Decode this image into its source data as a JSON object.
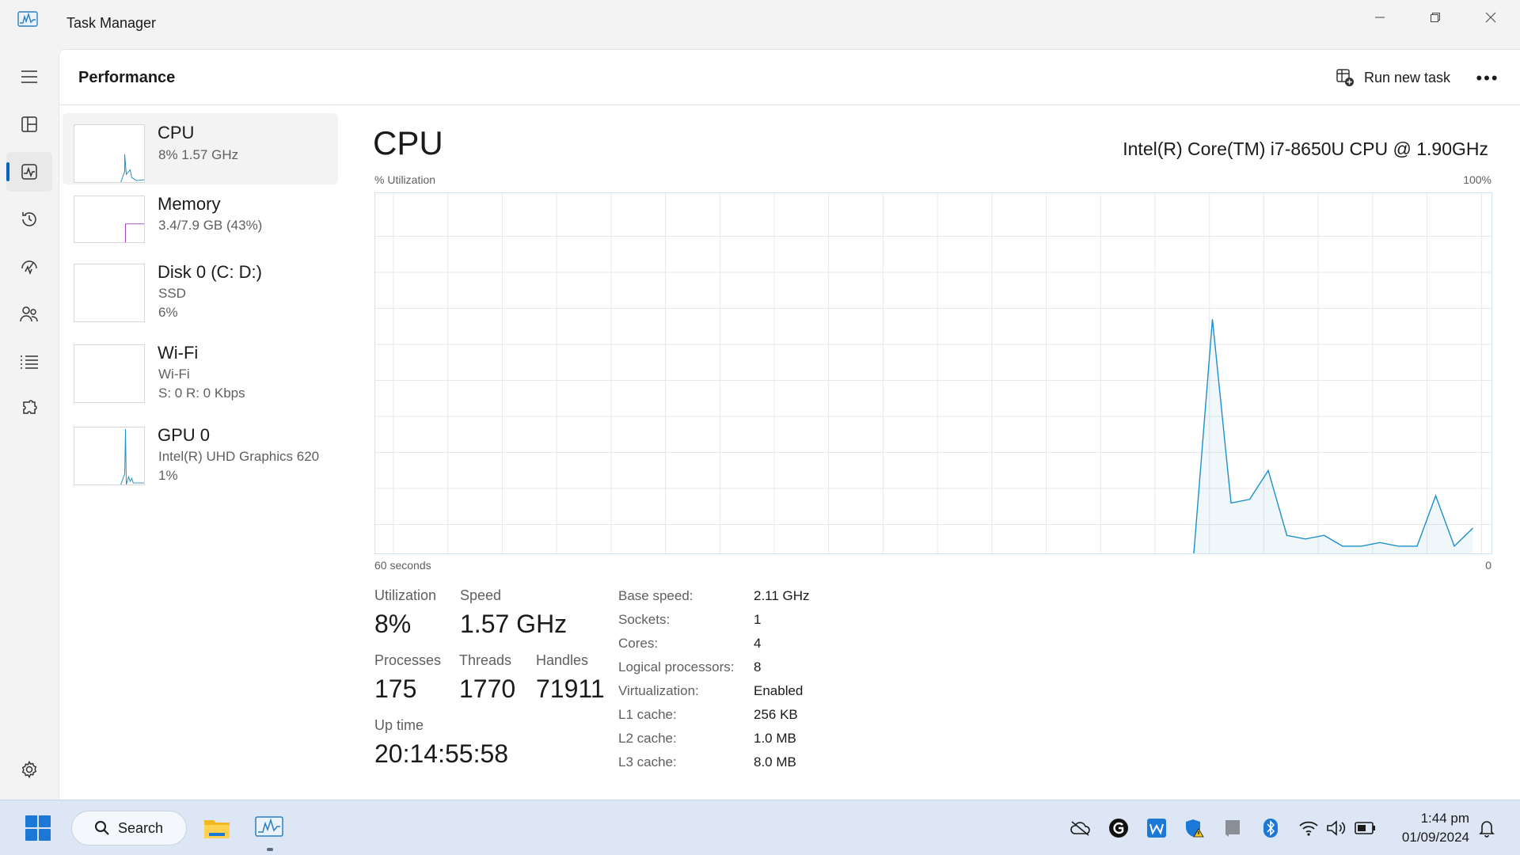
{
  "window": {
    "title": "Task Manager"
  },
  "header": {
    "title": "Performance",
    "run_new_task": "Run new task",
    "more": "•••"
  },
  "perf_items": [
    {
      "name": "CPU",
      "sub1": "8%  1.57 GHz",
      "sub2": ""
    },
    {
      "name": "Memory",
      "sub1": "3.4/7.9 GB (43%)",
      "sub2": ""
    },
    {
      "name": "Disk 0 (C: D:)",
      "sub1": "SSD",
      "sub2": "6%"
    },
    {
      "name": "Wi-Fi",
      "sub1": "Wi-Fi",
      "sub2": "S: 0  R: 0 Kbps"
    },
    {
      "name": "GPU 0",
      "sub1": "Intel(R) UHD Graphics 620",
      "sub2": "1%"
    }
  ],
  "detail": {
    "title": "CPU",
    "model": "Intel(R) Core(TM) i7-8650U CPU @ 1.90GHz",
    "y_label": "% Utilization",
    "y_max_label": "100%",
    "x_left_label": "60 seconds",
    "x_right_label": "0"
  },
  "stats": {
    "utilization_label": "Utilization",
    "utilization": "8%",
    "speed_label": "Speed",
    "speed": "1.57 GHz",
    "processes_label": "Processes",
    "processes": "175",
    "threads_label": "Threads",
    "threads": "1770",
    "handles_label": "Handles",
    "handles": "71911",
    "uptime_label": "Up time",
    "uptime": "20:14:55:58"
  },
  "specs": [
    {
      "label": "Base speed:",
      "value": "2.11 GHz"
    },
    {
      "label": "Sockets:",
      "value": "1"
    },
    {
      "label": "Cores:",
      "value": "4"
    },
    {
      "label": "Logical processors:",
      "value": "8"
    },
    {
      "label": "Virtualization:",
      "value": "Enabled"
    },
    {
      "label": "L1 cache:",
      "value": "256 KB"
    },
    {
      "label": "L2 cache:",
      "value": "1.0 MB"
    },
    {
      "label": "L3 cache:",
      "value": "8.0 MB"
    }
  ],
  "taskbar": {
    "search": "Search",
    "time": "1:44 pm",
    "date": "01/09/2024"
  },
  "colors": {
    "accent": "#0067c0",
    "cpu_line": "#1f8fc8",
    "memory_line": "#9b3fb5",
    "graph_grid": "#e8e8e8"
  },
  "chart_data": {
    "type": "area",
    "x_range": [
      60,
      0
    ],
    "ylim": [
      0,
      100
    ],
    "grid": true,
    "values_by_sec_ago": [
      [
        16,
        0
      ],
      [
        15,
        65
      ],
      [
        14,
        14
      ],
      [
        13,
        15
      ],
      [
        12,
        23
      ],
      [
        11,
        5
      ],
      [
        10,
        4
      ],
      [
        9,
        5
      ],
      [
        8,
        2
      ],
      [
        7,
        2
      ],
      [
        6,
        3
      ],
      [
        5,
        2
      ],
      [
        4,
        2
      ],
      [
        3,
        16
      ],
      [
        2,
        2
      ],
      [
        1,
        7
      ]
    ]
  }
}
